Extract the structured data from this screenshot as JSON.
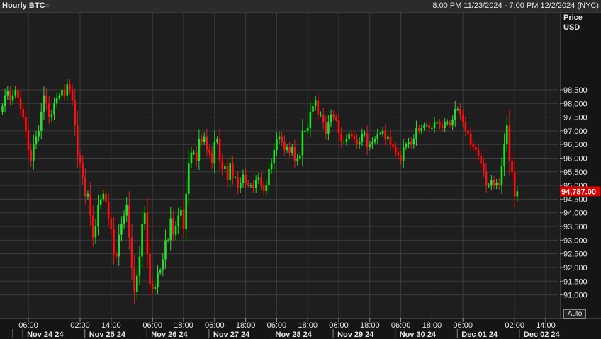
{
  "header": {
    "title": "Hourly BTC=",
    "range": "8:00 PM 11/23/2024 - 7:00 PM 12/2/2024 (NYC)"
  },
  "axis": {
    "price_label": "Price",
    "currency_label": "USD",
    "auto_label": "Auto"
  },
  "chart_data": {
    "type": "candlestick",
    "title": "Hourly BTC=",
    "ylabel": "Price USD",
    "ylim": [
      90500,
      99300
    ],
    "yticks": [
      91000,
      91500,
      92000,
      92500,
      93000,
      93500,
      94000,
      94500,
      95000,
      95500,
      96000,
      96500,
      97000,
      97500,
      98000,
      98500
    ],
    "ytick_labels": [
      "91,000",
      "91,500",
      "92,000",
      "92,500",
      "93,000",
      "93,500",
      "94,000",
      "94,500",
      "95,000",
      "95,500",
      "96,000",
      "96,500",
      "97,000",
      "97,500",
      "98,000",
      "98,500"
    ],
    "last_price": 94787,
    "last_price_label": "94,787.00",
    "bull_color": "#22e022",
    "bear_color": "#ff1010",
    "last_price_color": "#e00000",
    "time_labels": [
      {
        "hour": 10,
        "label": "06:00"
      },
      {
        "hour": 30,
        "label": "02:00"
      },
      {
        "hour": 42,
        "label": "14:00"
      },
      {
        "hour": 58,
        "label": "06:00"
      },
      {
        "hour": 70,
        "label": "18:00"
      },
      {
        "hour": 82,
        "label": "06:00"
      },
      {
        "hour": 94,
        "label": "18:00"
      },
      {
        "hour": 106,
        "label": "06:00"
      },
      {
        "hour": 118,
        "label": "18:00"
      },
      {
        "hour": 130,
        "label": "06:00"
      },
      {
        "hour": 142,
        "label": "18:00"
      },
      {
        "hour": 154,
        "label": "06:00"
      },
      {
        "hour": 166,
        "label": "18:00"
      },
      {
        "hour": 178,
        "label": "06:00"
      },
      {
        "hour": 198,
        "label": "02:00"
      },
      {
        "hour": 210,
        "label": "14:00"
      }
    ],
    "day_labels": [
      {
        "hour": 4,
        "label": "Nov 24 24"
      },
      {
        "hour": 28,
        "label": "Nov 25 24"
      },
      {
        "hour": 52,
        "label": "Nov 26 24"
      },
      {
        "hour": 76,
        "label": "Nov 27 24"
      },
      {
        "hour": 100,
        "label": "Nov 28 24"
      },
      {
        "hour": 124,
        "label": "Nov 29 24"
      },
      {
        "hour": 148,
        "label": "Nov 30 24"
      },
      {
        "hour": 172,
        "label": "Dec 01 24"
      },
      {
        "hour": 196,
        "label": "Dec 02 24"
      }
    ],
    "closes": [
      97900,
      98300,
      98450,
      98100,
      98300,
      98500,
      98200,
      97800,
      97500,
      97000,
      96300,
      95900,
      96500,
      96800,
      97000,
      97700,
      98300,
      98000,
      97500,
      97600,
      98000,
      98200,
      98300,
      98500,
      98300,
      98700,
      98500,
      98100,
      97200,
      96100,
      95800,
      95300,
      94600,
      94700,
      93900,
      93100,
      93500,
      94300,
      94500,
      94700,
      94400,
      93800,
      93400,
      92500,
      92400,
      93200,
      93600,
      93900,
      94300,
      93100,
      92000,
      91100,
      91700,
      92400,
      93600,
      94000,
      92500,
      91400,
      91200,
      91300,
      91800,
      91900,
      92300,
      93000,
      93000,
      93800,
      93200,
      93500,
      93900,
      94100,
      93400,
      94700,
      95800,
      96200,
      96200,
      95900,
      96700,
      96600,
      96800,
      96300,
      96200,
      95800,
      96600,
      96700,
      95900,
      95600,
      95700,
      95200,
      95800,
      95300,
      95300,
      94900,
      95100,
      95400,
      95100,
      95000,
      95000,
      94900,
      95200,
      95300,
      95000,
      94800,
      95000,
      95600,
      95800,
      96300,
      96700,
      96800,
      96600,
      96300,
      96400,
      96200,
      96400,
      95900,
      96000,
      96100,
      97000,
      97000,
      97100,
      97700,
      97900,
      98100,
      97600,
      97600,
      97300,
      96900,
      97300,
      97600,
      97500,
      97400,
      96900,
      96600,
      96600,
      96700,
      96900,
      96800,
      96700,
      96500,
      96600,
      96900,
      96900,
      96400,
      96500,
      96600,
      96700,
      96900,
      96900,
      97000,
      96700,
      96800,
      96500,
      96400,
      96200,
      96100,
      95900,
      96400,
      96500,
      96600,
      96500,
      96700,
      97100,
      97000,
      97100,
      97200,
      97200,
      97100,
      97100,
      97300,
      97300,
      97200,
      97100,
      97300,
      97300,
      97200,
      97400,
      97800,
      97800,
      97600,
      97300,
      97000,
      96900,
      96500,
      96400,
      96300,
      96100,
      95800,
      95500,
      95000,
      95000,
      95200,
      95000,
      95100,
      95000,
      95700,
      96500,
      97200,
      95900,
      95500,
      94600,
      94787
    ]
  }
}
